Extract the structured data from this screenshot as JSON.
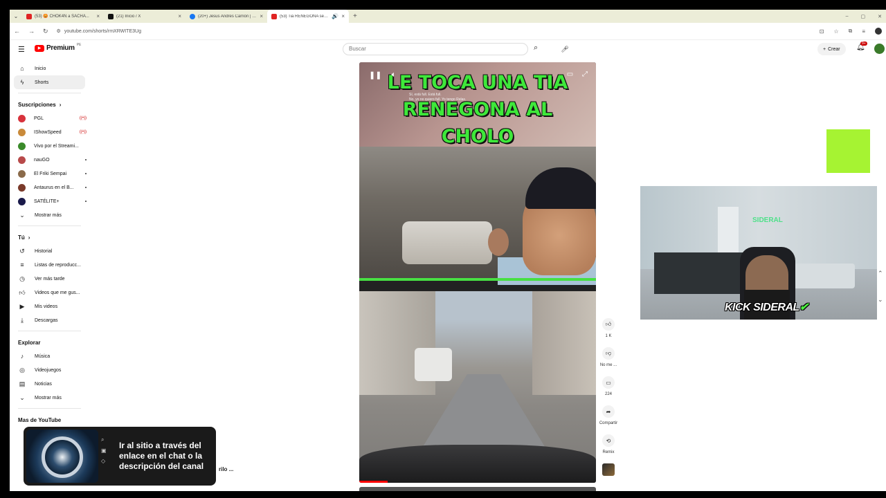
{
  "browser": {
    "tabs": [
      {
        "title": "(53) 😡 CHOK4N a SACHA... ",
        "active": false,
        "color": "#e02424"
      },
      {
        "title": "(21) Inicio / X",
        "active": false,
        "color": "#111111"
      },
      {
        "title": "(20+) Jesus Andres Carrión | Fa...",
        "active": false,
        "color": "#1877f2"
      },
      {
        "title": "(53) Tia RENEGONA se sutil...",
        "active": true,
        "color": "#e02424"
      }
    ],
    "url": "youtube.com/shorts/rmXRWITE3Ug"
  },
  "header": {
    "logo_text": "Premium",
    "logo_country": "PE",
    "search_placeholder": "Buscar",
    "create_label": "Crear",
    "notif_count": "9+"
  },
  "sidebar": {
    "main": [
      {
        "label": "Inicio",
        "icon": "home-icon",
        "glyph": "⌂"
      },
      {
        "label": "Shorts",
        "icon": "shorts-icon",
        "glyph": "ϟ"
      }
    ],
    "subs_header": "Suscripciones",
    "subs": [
      {
        "label": "PGL",
        "color": "#d8323c",
        "status": "live"
      },
      {
        "label": "IShowSpeed",
        "color": "#c98a3a",
        "status": "live"
      },
      {
        "label": "Vivo por el Streami...",
        "color": "#3a8a2a",
        "status": ""
      },
      {
        "label": "nauGO",
        "color": "#b84a4a",
        "status": "dot"
      },
      {
        "label": "El Friki Sempai",
        "color": "#8a6a4a",
        "status": "dot"
      },
      {
        "label": "Antaurus en el B...",
        "color": "#7a3a2a",
        "status": "dot"
      },
      {
        "label": "SATÉLITE+",
        "color": "#1a1a4a",
        "status": "dot"
      }
    ],
    "subs_more": "Mostrar más",
    "you_header": "Tú",
    "you": [
      {
        "label": "Historial",
        "glyph": "↺"
      },
      {
        "label": "Listas de reproducc...",
        "glyph": "≡"
      },
      {
        "label": "Ver más tarde",
        "glyph": "◷"
      },
      {
        "label": "Videos que me gus...",
        "glyph": "👍"
      },
      {
        "label": "Mis videos",
        "glyph": "▶"
      },
      {
        "label": "Descargas",
        "glyph": "⤓"
      }
    ],
    "explore_header": "Explorar",
    "explore": [
      {
        "label": "Música",
        "glyph": "♪"
      },
      {
        "label": "Videojuegos",
        "glyph": "◎"
      },
      {
        "label": "Noticias",
        "glyph": "▤"
      }
    ],
    "explore_more": "Mostrar más",
    "more_header": "Mas de YouTube"
  },
  "video": {
    "title_lines": [
      "LE TOCA UNA TIA",
      "RENEGONA AL",
      "CHOLO"
    ],
    "caption_lines": [
      "Sí, está full. Está full.",
      "No, yo no quiero full. Yo tengo Relax."
    ],
    "progress": 0.12
  },
  "actions": {
    "like_count": "1 K",
    "dislike_label": "No me ...",
    "comments_count": "224",
    "share_label": "Compartir",
    "remix_label": "Remix"
  },
  "overlay": {
    "brand_kick": "KICK",
    "brand_name": "SIDERAL",
    "room_logo": "SIDERAL",
    "notification_text": "Ir al sitio a través del enlace en el chat o la descripción del canal",
    "bg_fragment": "rilo  ..."
  }
}
